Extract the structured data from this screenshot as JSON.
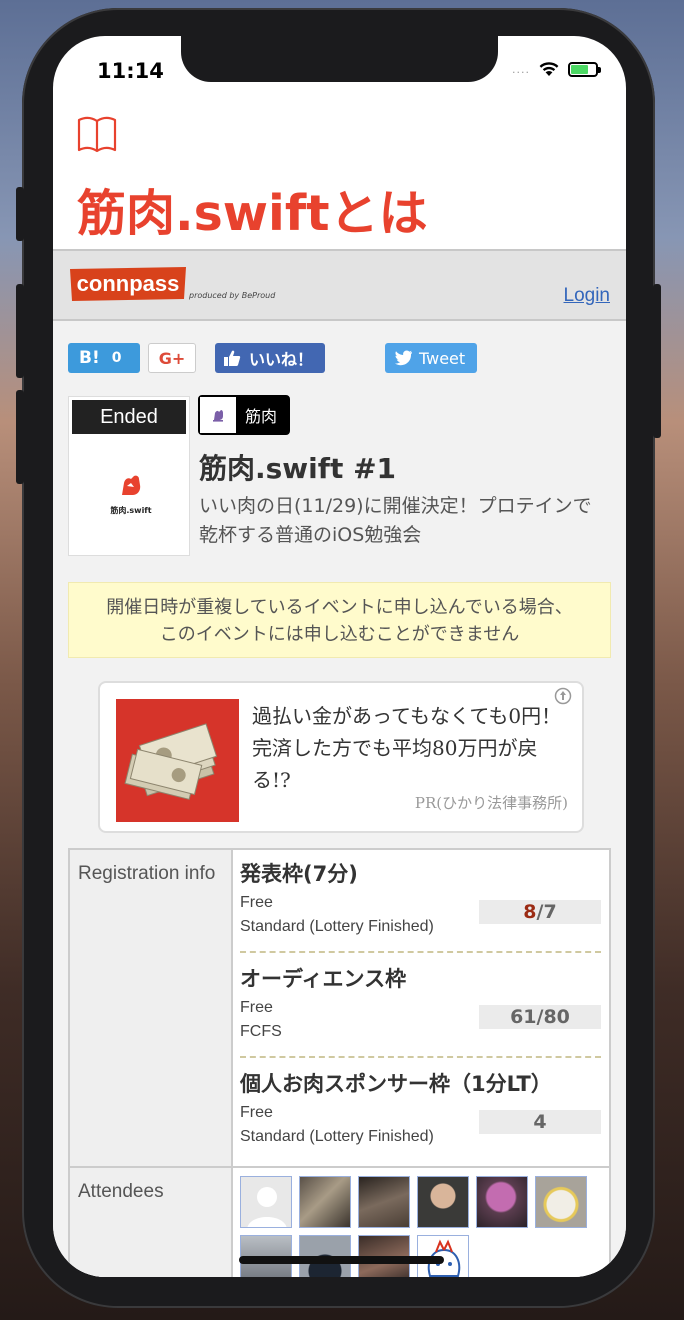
{
  "status_bar": {
    "time": "11:14",
    "signal": "....",
    "wifi_icon": "wifi-icon",
    "battery_icon": "battery-charging-icon"
  },
  "app_header": {
    "icon": "book-icon",
    "title": "筋肉.swiftとは",
    "accent_color": "#e8422e"
  },
  "site": {
    "logo_text": "connpass",
    "produced_by": "produced by BeProud",
    "login_label": "Login"
  },
  "share": {
    "hatena_label": "B!",
    "hatena_count": "0",
    "gplus_label": "G+",
    "facebook_label": "いいね！",
    "tweet_label": "Tweet"
  },
  "event": {
    "status_badge": "Ended",
    "thumb_logo_text": "筋肉.swift",
    "group_tag": "筋肉",
    "title": "筋肉.swift #1",
    "description": "いい肉の日(11/29)に開催決定！プロテインで乾杯する普通のiOS勉強会"
  },
  "warning": {
    "line1": "開催日時が重複しているイベントに申し込んでいる場合、",
    "line2": "このイベントには申し込むことができません"
  },
  "ad": {
    "text": "過払い金があってもなくても0円！完済した方でも平均80万円が戻る!?",
    "source": "PR(ひかり法律事務所)"
  },
  "registration": {
    "label": "Registration info",
    "tickets": [
      {
        "name": "発表枠(7分)",
        "price": "Free",
        "method": "Standard (Lottery Finished)",
        "count_current": "8",
        "count_sep": "/7",
        "count_full": ""
      },
      {
        "name": "オーディエンス枠",
        "price": "Free",
        "method": "FCFS",
        "count_current": "",
        "count_sep": "",
        "count_full": "61/80"
      },
      {
        "name": "個人お肉スポンサー枠（1分LT）",
        "price": "Free",
        "method": "Standard (Lottery Finished)",
        "count_current": "",
        "count_sep": "",
        "count_full": "4"
      }
    ]
  },
  "attendees": {
    "label": "Attendees"
  }
}
